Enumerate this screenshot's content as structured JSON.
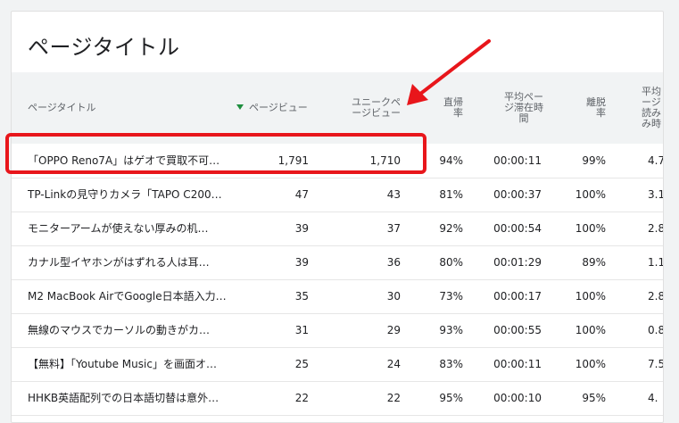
{
  "card": {
    "title": "ページタイトル"
  },
  "columns": {
    "title": "ページタイトル",
    "pageviews": "ページビュー",
    "unique_line1": "ユニークペ",
    "unique_line2": "ージビュー",
    "bounce_line1": "直帰",
    "bounce_line2": "率",
    "avgtime_line1": "平均ペー",
    "avgtime_line2": "ジ滞在時",
    "avgtime_line3": "間",
    "exit_line1": "離脱",
    "exit_line2": "率",
    "avgload_line1": "平均",
    "avgload_line2": "ージ",
    "avgload_line3": "読み",
    "avgload_line4": "み時"
  },
  "rows": [
    {
      "title": "「OPPO Reno7A」はゲオで買取不可…",
      "pageviews": "1,791",
      "unique": "1,710",
      "bounce": "94%",
      "time": "00:00:11",
      "exit": "99%",
      "avg": "4.7"
    },
    {
      "title": "TP-Linkの見守りカメラ「TAPO C200…",
      "pageviews": "47",
      "unique": "43",
      "bounce": "81%",
      "time": "00:00:37",
      "exit": "100%",
      "avg": "3.1"
    },
    {
      "title": "モニターアームが使えない厚みの机…",
      "pageviews": "39",
      "unique": "37",
      "bounce": "92%",
      "time": "00:00:54",
      "exit": "100%",
      "avg": "2.8"
    },
    {
      "title": "カナル型イヤホンがはずれる人は耳…",
      "pageviews": "39",
      "unique": "36",
      "bounce": "80%",
      "time": "00:01:29",
      "exit": "89%",
      "avg": "1.1"
    },
    {
      "title": "M2 MacBook AirでGoogle日本語入力…",
      "pageviews": "35",
      "unique": "30",
      "bounce": "73%",
      "time": "00:00:17",
      "exit": "100%",
      "avg": "2.8"
    },
    {
      "title": "無線のマウスでカーソルの動きがカ…",
      "pageviews": "31",
      "unique": "29",
      "bounce": "93%",
      "time": "00:00:55",
      "exit": "100%",
      "avg": "0.8"
    },
    {
      "title": "【無料】「Youtube Music」を画面オ…",
      "pageviews": "25",
      "unique": "24",
      "bounce": "83%",
      "time": "00:00:11",
      "exit": "100%",
      "avg": "7.5"
    },
    {
      "title": "HHKB英語配列での日本語切替は意外…",
      "pageviews": "22",
      "unique": "22",
      "bounce": "95%",
      "time": "00:00:10",
      "exit": "95%",
      "avg": "4."
    }
  ],
  "annotation": {
    "color": "#e8161b"
  },
  "colors": {
    "sort_arrow": "#1e8e3e",
    "header_bg": "#f1f3f4"
  }
}
